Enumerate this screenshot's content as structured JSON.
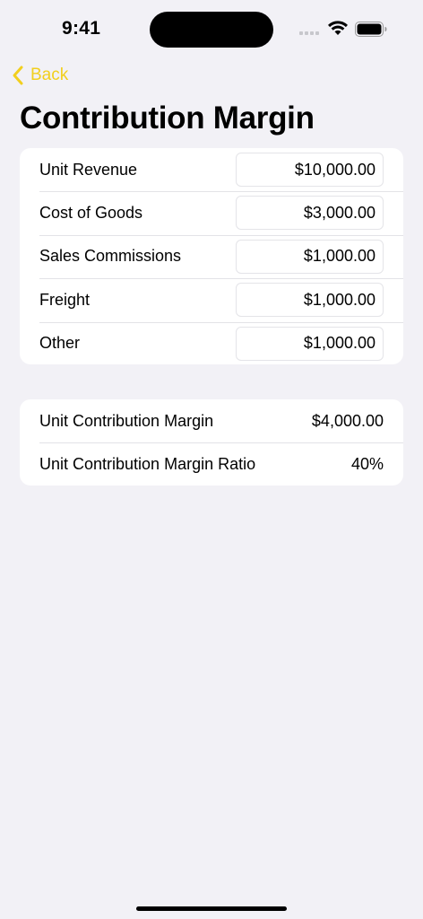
{
  "status_bar": {
    "time": "9:41"
  },
  "nav": {
    "back_label": "Back",
    "accent_color": "#f2cf1e"
  },
  "page": {
    "title": "Contribution Margin"
  },
  "inputs": [
    {
      "label": "Unit Revenue",
      "value": "$10,000.00"
    },
    {
      "label": "Cost of Goods",
      "value": "$3,000.00"
    },
    {
      "label": "Sales Commissions",
      "value": "$1,000.00"
    },
    {
      "label": "Freight",
      "value": "$1,000.00"
    },
    {
      "label": "Other",
      "value": "$1,000.00"
    }
  ],
  "results": [
    {
      "label": "Unit Contribution Margin",
      "value": "$4,000.00"
    },
    {
      "label": "Unit Contribution Margin Ratio",
      "value": "40%"
    }
  ],
  "icons": {
    "back": "chevron-left-icon",
    "signal": "cellular-signal-icon",
    "wifi": "wifi-icon",
    "battery": "battery-icon"
  }
}
